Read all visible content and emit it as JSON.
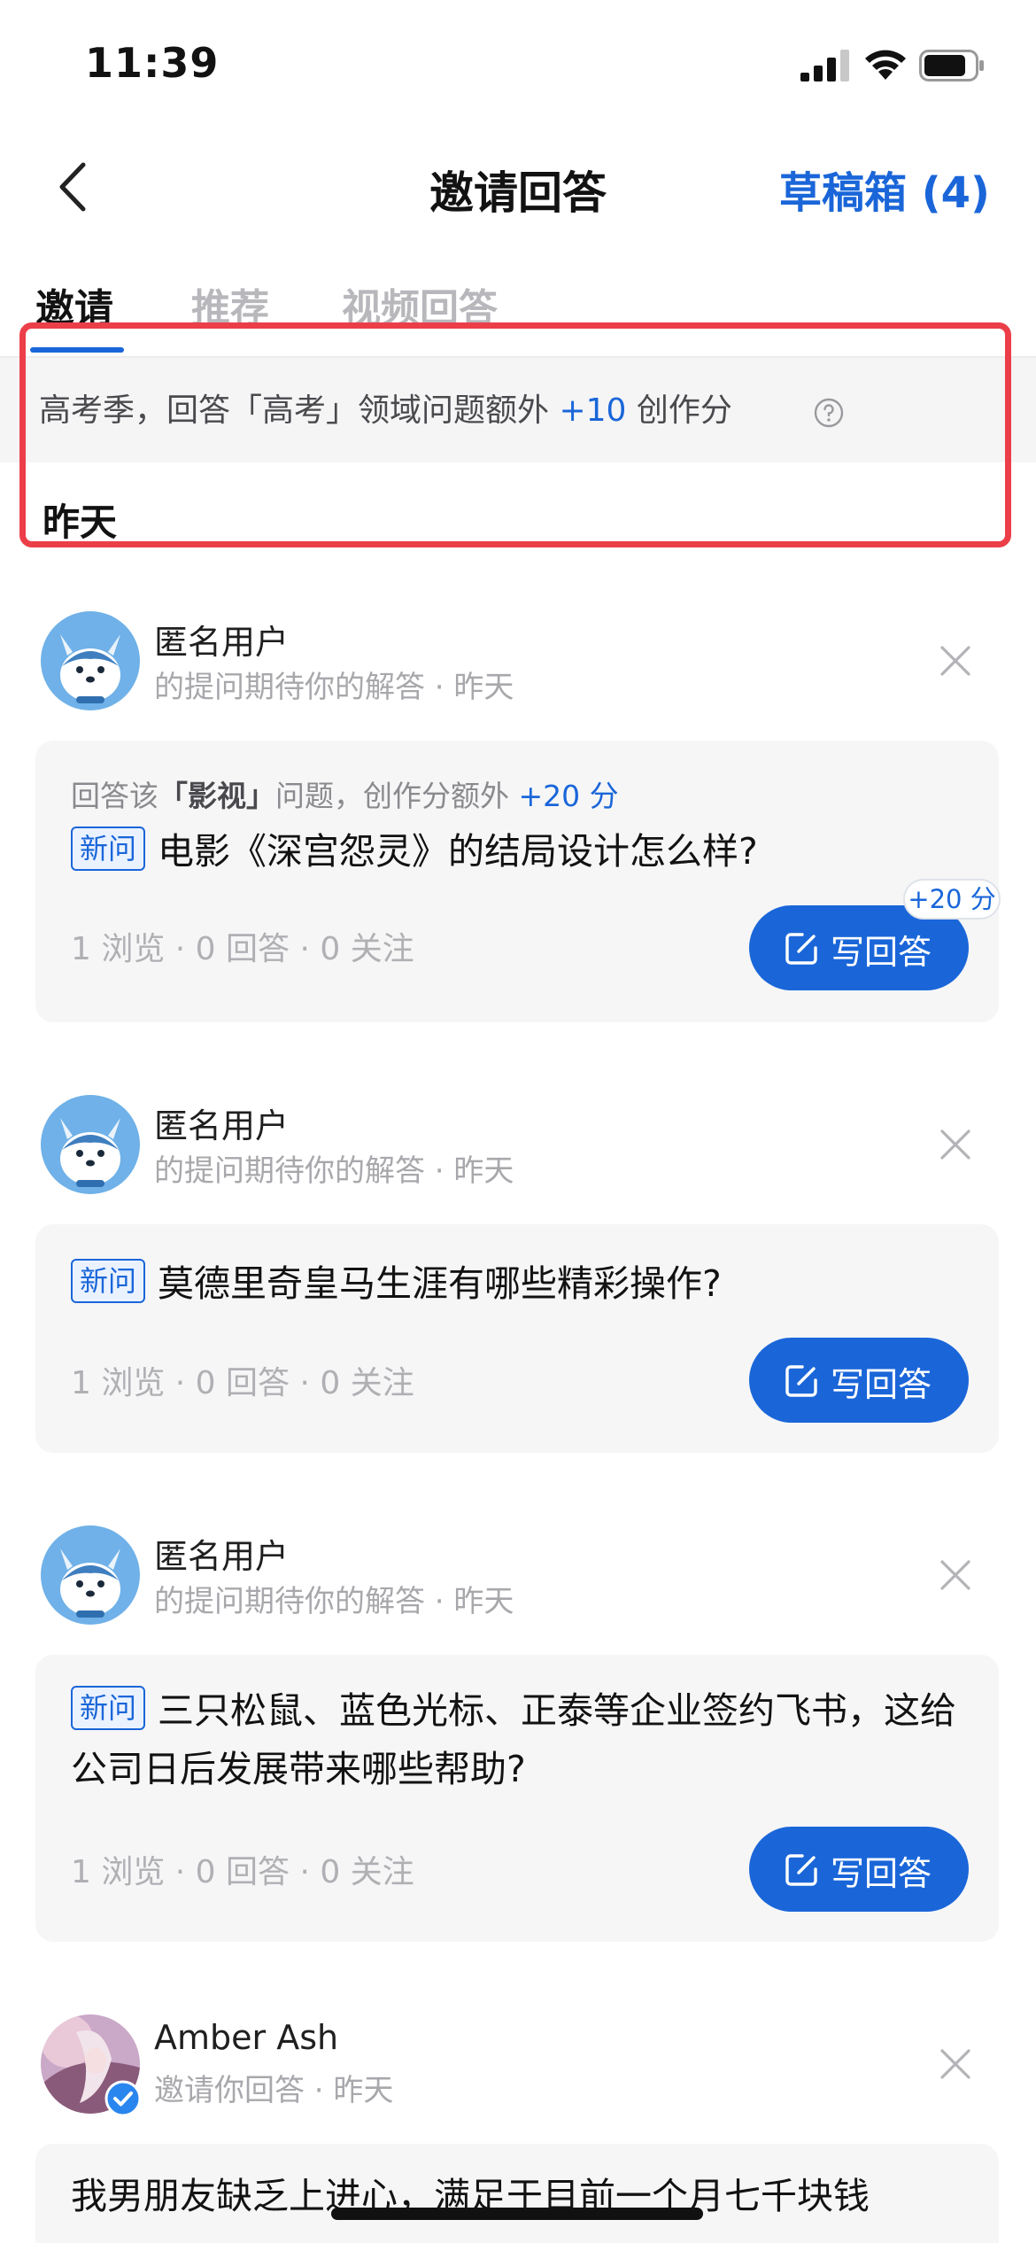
{
  "status": {
    "time": "11:39"
  },
  "nav": {
    "title": "邀请回答",
    "drafts": "草稿箱 (4)"
  },
  "tabs": [
    {
      "label": "邀请",
      "active": true
    },
    {
      "label": "推荐",
      "active": false
    },
    {
      "label": "视频回答",
      "active": false
    }
  ],
  "banner": {
    "text_before": "高考季，回答「高考」领域问题额外 ",
    "highlight": "+10",
    "text_after": " 创作分"
  },
  "section_date": "昨天",
  "items": [
    {
      "user": "匿名用户",
      "subtitle": "的提问期待你的解答 · 昨天",
      "hint_prefix": "回答该",
      "hint_topic": "「影视」",
      "hint_mid": "问题，创作分额外 ",
      "hint_bonus": "+20 分",
      "tag": "新问",
      "question": "电影《深宫怨灵》的结局设计怎么样?",
      "stats": "1 浏览 · 0 回答 · 0 关注",
      "button": "写回答",
      "badge": "+20 分"
    },
    {
      "user": "匿名用户",
      "subtitle": "的提问期待你的解答 · 昨天",
      "tag": "新问",
      "question": "莫德里奇皇马生涯有哪些精彩操作?",
      "stats": "1 浏览 · 0 回答 · 0 关注",
      "button": "写回答"
    },
    {
      "user": "匿名用户",
      "subtitle": "的提问期待你的解答 · 昨天",
      "tag": "新问",
      "question": "三只松鼠、蓝色光标、正泰等企业签约飞书，这给公司日后发展带来哪些帮助?",
      "stats": "1 浏览 · 0 回答 · 0 关注",
      "button": "写回答"
    },
    {
      "user": "Amber Ash",
      "subtitle": "邀请你回答 · 昨天",
      "question": "我男朋友缺乏上进心，满足于目前一个月七千块钱"
    }
  ],
  "colors": {
    "accent": "#1a66d9",
    "highlight_border": "#ec3e49",
    "card_bg": "#f6f6f7"
  }
}
